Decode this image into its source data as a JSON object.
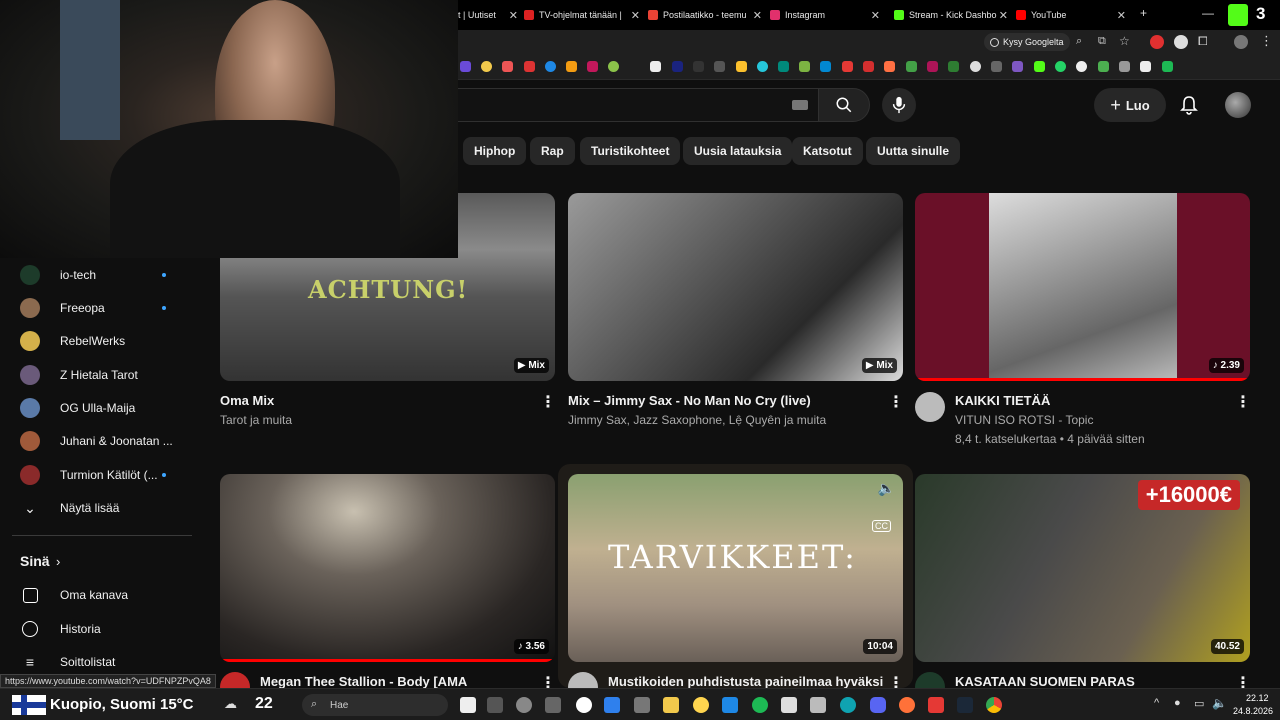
{
  "browser": {
    "tabs": [
      {
        "label": "t | Uutiset",
        "color": "#e33"
      },
      {
        "label": "TV-ohjelmat tänään |",
        "color": "#d22"
      },
      {
        "label": "Postilaatikko - teemu",
        "color": "#ea4335"
      },
      {
        "label": "Instagram",
        "color": "#e1306c"
      },
      {
        "label": "Stream - Kick Dashbo",
        "color": "#53fc18"
      },
      {
        "label": "YouTube",
        "color": "#ff0000"
      }
    ],
    "new_tab": "+",
    "kick_badge": "3",
    "google_lens_label": "Kysy Googlelta"
  },
  "header": {
    "create_label": "Luo",
    "icons": {
      "search": "search-icon",
      "mic": "mic-icon",
      "bell": "bell-icon",
      "keyboard": "keyboard-icon"
    }
  },
  "chips": [
    "Hiphop",
    "Rap",
    "Turistikohteet",
    "Uusia latauksia",
    "Katsotut",
    "Uutta sinulle"
  ],
  "sidebar": {
    "subscriptions": [
      {
        "label": "io-tech",
        "dot": true,
        "color": "#1d3b2a"
      },
      {
        "label": "Freeopa",
        "dot": true,
        "color": "#8b6a4f"
      },
      {
        "label": "RebelWerks",
        "dot": false,
        "color": "#d4b04a"
      },
      {
        "label": "Z Hietala Tarot",
        "dot": false,
        "color": "#6a5a7a"
      },
      {
        "label": "OG Ulla-Maija",
        "dot": false,
        "color": "#5a7aa8"
      },
      {
        "label": "Juhani & Joonatan ...",
        "dot": false,
        "color": "#a05a3a"
      },
      {
        "label": "Turmion Kätilöt (...",
        "dot": true,
        "color": "#8a2a2a"
      }
    ],
    "show_more": "Näytä lisää",
    "you_label": "Sinä",
    "you_items": [
      "Oma kanava",
      "Historia",
      "Soittolistat"
    ]
  },
  "videos": [
    {
      "title": "Oma Mix",
      "channel": "Tarot ja muita",
      "meta": "",
      "badge": "Mix",
      "thumb_text": "ACHTUNG!"
    },
    {
      "title": "Mix – Jimmy Sax - No Man No Cry  (live)",
      "channel": "Jimmy Sax, Jazz Saxophone, Lệ Quyên ja muita",
      "meta": "",
      "badge": "Mix",
      "thumb_text": ""
    },
    {
      "title": "KAIKKI TIETÄÄ",
      "channel": "VITUN ISO ROTSI - Topic",
      "meta": "8,4 t. katselukertaa • 4 päivää sitten",
      "badge": "2.39",
      "thumb_text": ""
    },
    {
      "title": "Megan Thee Stallion - Body [AMA",
      "channel": "",
      "meta": "",
      "badge": "3.56",
      "thumb_text": ""
    },
    {
      "title": "Mustikoiden puhdistusta paineilmaa hyväksi",
      "channel": "",
      "meta": "",
      "badge": "10:04",
      "thumb_text": "TARVIKKEET:"
    },
    {
      "title": "KASATAAN SUOMEN PARAS",
      "channel": "",
      "meta": "",
      "badge": "40.52",
      "thumb_text": "+16000€"
    }
  ],
  "status_url": "https://www.youtube.com/watch?v=UDFNPZPvQA8",
  "taskbar": {
    "weather": "Kuopio, Suomi 15°C",
    "big_number": "22",
    "search_placeholder": "Hae",
    "time": "22.12",
    "date": "24.8.2026"
  }
}
